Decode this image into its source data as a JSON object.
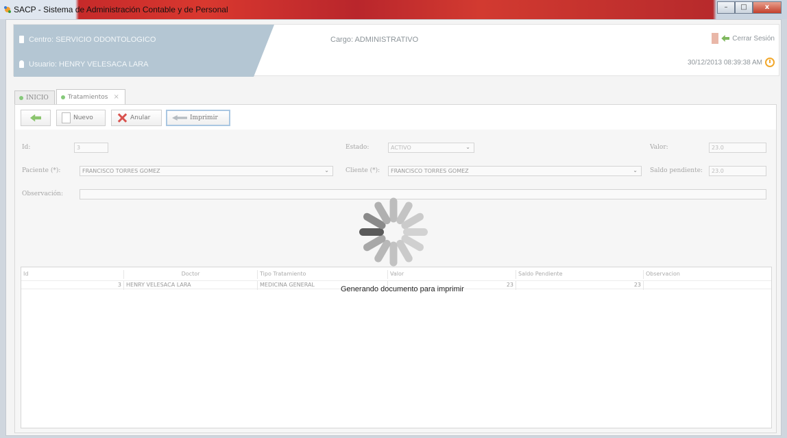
{
  "window": {
    "title": "SACP - Sistema de Administración Contable y de Personal",
    "controls": [
      "minimize",
      "maximize",
      "close"
    ]
  },
  "header": {
    "centro": "Centro: SERVICIO ODONTOLOGICO",
    "usuario": "Usuario: HENRY VELESACA LARA",
    "cargo": "Cargo:  ADMINISTRATIVO",
    "logout_label": "Cerrar Sesión",
    "datetime": "30/12/2013 08:39:38 AM",
    "accent_color": "#b6c8d4"
  },
  "tabs": [
    {
      "label": "INICIO",
      "active": false
    },
    {
      "label": "Tratamientos",
      "active": true
    }
  ],
  "toolbar": {
    "nuevo": "Nuevo",
    "anular": "Anular",
    "imprimir": "Imprimir"
  },
  "form": {
    "id_label": "Id:",
    "id_value": "3",
    "estado_label": "Estado:",
    "estado_value": "ACTIVO",
    "valor_label": "Valor:",
    "valor_value": "23.0",
    "paciente_label": "Paciente (*):",
    "paciente_value": "FRANCISCO TORRES GOMEZ",
    "cliente_label": "Cliente (*):",
    "cliente_value": "FRANCISCO TORRES GOMEZ",
    "saldo_label": "Saldo pendiente:",
    "saldo_value": "23.0",
    "observacion_label": "Observación:",
    "observacion_value": ""
  },
  "table": {
    "columns": [
      "Id",
      "Doctor",
      "Tipo Tratamiento",
      "Valor",
      "Saldo Pendiente",
      "Observacion"
    ],
    "rows": [
      [
        "3",
        "HENRY VELESACA LARA",
        "MEDICINA GENERAL",
        "23",
        "23",
        ""
      ]
    ]
  },
  "loading": {
    "message": "Generando documento para imprimir"
  }
}
